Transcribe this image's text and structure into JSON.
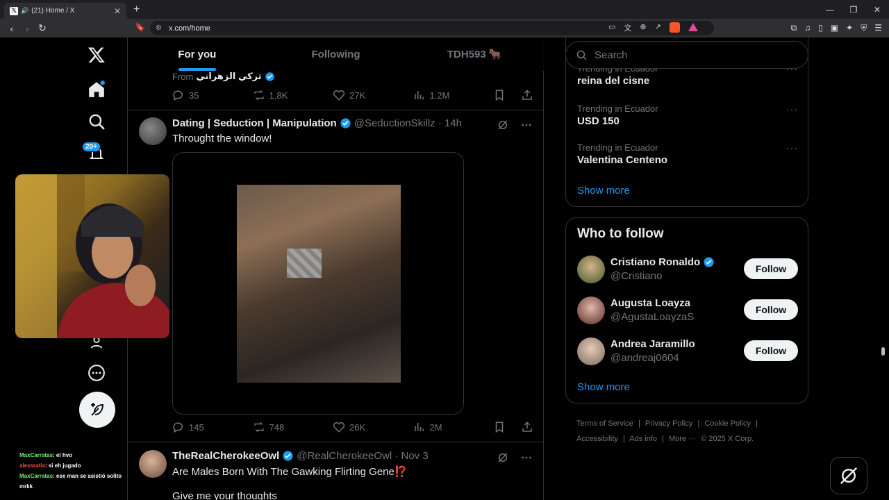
{
  "browser": {
    "tab_title": "(21) Home / X",
    "url": "x.com/home"
  },
  "nav": {
    "notif_badge": "20+"
  },
  "timeline": {
    "tabs": [
      "For you",
      "Following",
      "TDH593 🐂"
    ],
    "prev_tweet": {
      "from_label": "From",
      "from_name": "تركي الزهراني",
      "replies": "35",
      "reposts": "1.8K",
      "likes": "27K",
      "views": "1.2M"
    },
    "tweets": [
      {
        "name": "Dating | Seduction | Manipulation",
        "handle": "@SeductionSkillz · 14h",
        "text": "Throught the window!",
        "replies": "145",
        "reposts": "748",
        "likes": "26K",
        "views": "2M"
      },
      {
        "name": "TheRealCherokeeOwl",
        "handle": "@RealCherokeeOwl · Nov 3",
        "text": "Are Males Born With The Gawking Flirting Gene⁉️",
        "text2": "Give me your thoughts"
      }
    ]
  },
  "sidebar": {
    "search_placeholder": "Search",
    "trends": [
      {
        "context": "Trending in Ecuador",
        "topic": "reina del cisne"
      },
      {
        "context": "Trending in Ecuador",
        "topic": "USD 150"
      },
      {
        "context": "Trending in Ecuador",
        "topic": "Valentina Centeno"
      }
    ],
    "show_more": "Show more",
    "who_to_follow": {
      "title": "Who to follow",
      "people": [
        {
          "name": "Cristiano Ronaldo",
          "handle": "@Cristiano",
          "verified": true
        },
        {
          "name": "Augusta Loayza",
          "handle": "@AgustaLoayzaS",
          "verified": false
        },
        {
          "name": "Andrea Jaramillo",
          "handle": "@andreaj0604",
          "verified": false
        }
      ],
      "follow_label": "Follow",
      "show_more": "Show more"
    },
    "footer": {
      "links": [
        "Terms of Service",
        "|",
        "Privacy Policy",
        "|",
        "Cookie Policy",
        "|",
        "Accessibility",
        "|",
        "Ads info",
        "|",
        "More ···",
        "© 2025 X Corp."
      ]
    }
  },
  "stream_chat": [
    {
      "user": "MaxCarratas",
      "msg": ": el hvo"
    },
    {
      "user": "alexsratix",
      "msg": ": si eh jugado"
    },
    {
      "user": "MaxCarratas",
      "msg": ": ese man se asistió solito mrkk"
    }
  ],
  "colors": {
    "accent": "#1d9bf0",
    "background": "#000000",
    "text": "#e7e9ea",
    "muted": "#71767b"
  }
}
